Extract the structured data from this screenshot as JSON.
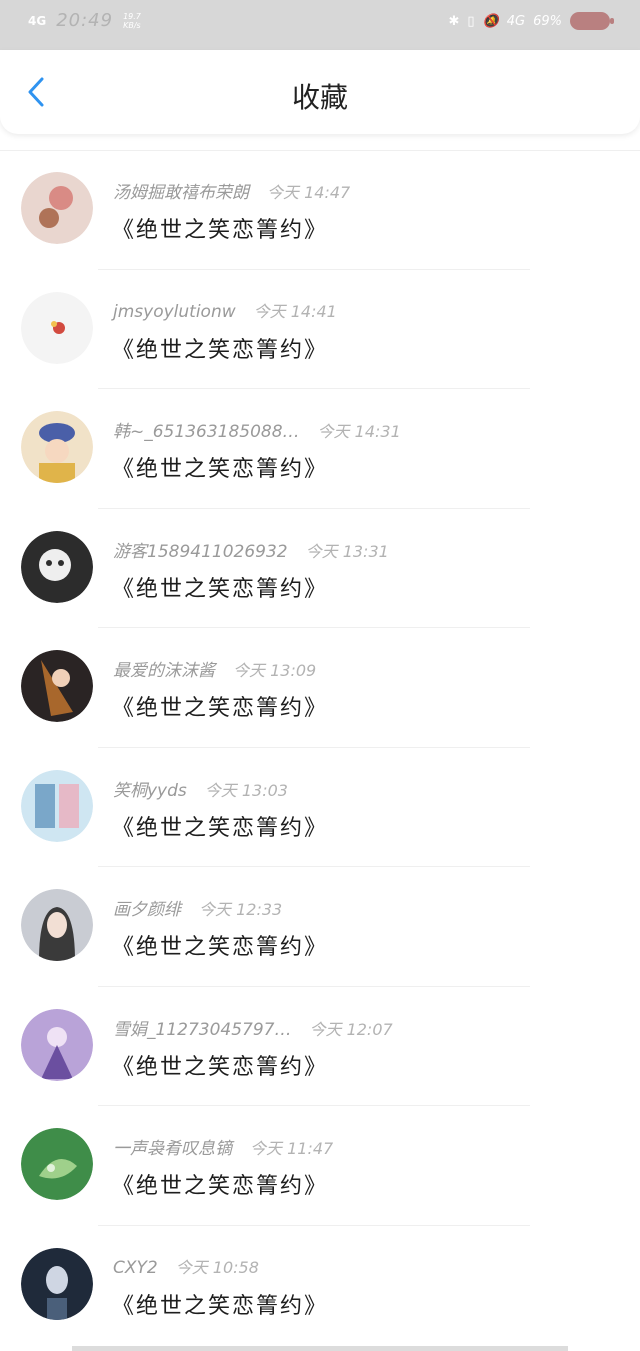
{
  "status_bar": {
    "network": "4G",
    "time": "20:49",
    "speed_value": "19.7",
    "speed_unit": "KB/s",
    "network_right": "4G",
    "battery": "69%"
  },
  "header": {
    "title": "收藏"
  },
  "list": [
    {
      "name": "汤姆掘敢禧布荣朗",
      "time": "今天 14:47",
      "content": "《绝世之笑恋箐约》",
      "avatar_color": "#e9d6cf",
      "accent": "#a05a3a"
    },
    {
      "name": "jmsyoylutionw",
      "time": "今天 14:41",
      "content": "《绝世之笑恋箐约》",
      "avatar_color": "#f4f4f4",
      "accent": "#d24a3f"
    },
    {
      "name": "韩~_651363185088…",
      "time": "今天 14:31",
      "content": "《绝世之笑恋箐约》",
      "avatar_color": "#f1e2c8",
      "accent": "#4a5fa8"
    },
    {
      "name": "游客1589411026932",
      "time": "今天 13:31",
      "content": "《绝世之笑恋箐约》",
      "avatar_color": "#2c2c2c",
      "accent": "#eeeeee"
    },
    {
      "name": "最爱的沫沫酱",
      "time": "今天 13:09",
      "content": "《绝世之笑恋箐约》",
      "avatar_color": "#2a2424",
      "accent": "#c8782e"
    },
    {
      "name": "笑桐yyds",
      "time": "今天 13:03",
      "content": "《绝世之笑恋箐约》",
      "avatar_color": "#cfe6f2",
      "accent": "#7aa7c9"
    },
    {
      "name": "画夕颜绯",
      "time": "今天 12:33",
      "content": "《绝世之笑恋箐约》",
      "avatar_color": "#c9ccd3",
      "accent": "#3a3a3a"
    },
    {
      "name": "雪娟_11273045797…",
      "time": "今天 12:07",
      "content": "《绝世之笑恋箐约》",
      "avatar_color": "#b9a3d8",
      "accent": "#6b4fa0"
    },
    {
      "name": "一声袅肴叹息镝",
      "time": "今天 11:47",
      "content": "《绝世之笑恋箐约》",
      "avatar_color": "#3f8d49",
      "accent": "#9fd08b"
    },
    {
      "name": "CXY2",
      "time": "今天 10:58",
      "content": "《绝世之笑恋箐约》",
      "avatar_color": "#1f2a3a",
      "accent": "#cfd6e3"
    }
  ]
}
